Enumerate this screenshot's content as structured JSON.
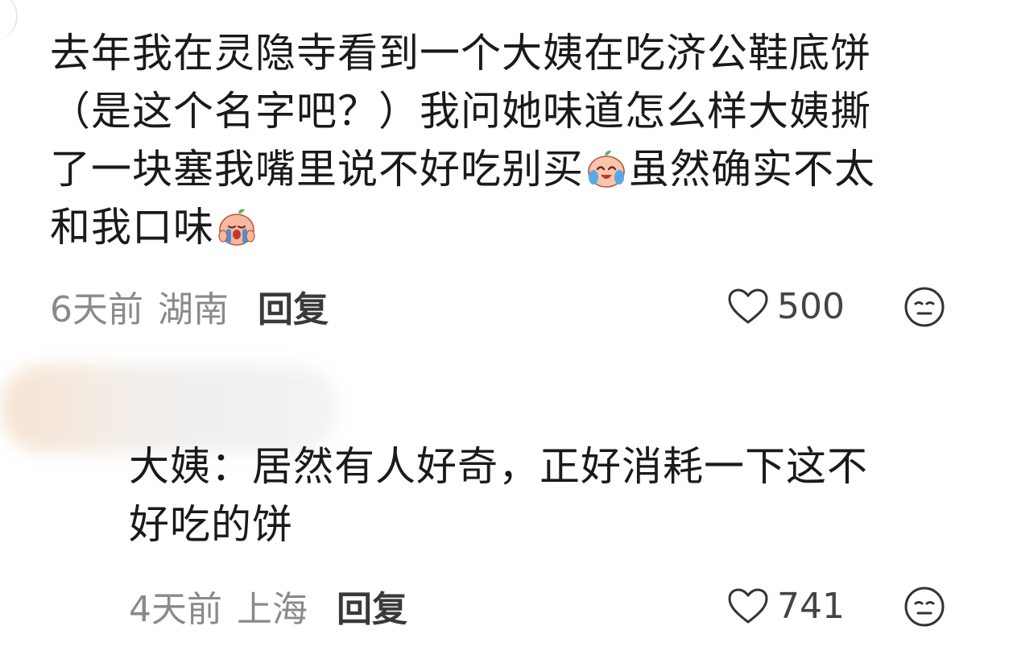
{
  "comments": [
    {
      "text_lines": [
        "去年我在灵隐寺看到一个大姨在吃济公鞋底饼",
        "（是这个名字吧？）我问她味道怎么样大姨撕",
        "了一块塞我嘴里说不好吃别买",
        "虽然确实不太",
        "和我口味"
      ],
      "emojis": [
        "laughing-crying-emoji",
        "crying-emoji"
      ],
      "time": "6天前",
      "location": "湖南",
      "reply_label": "回复",
      "likes": "500",
      "dislike_icon": "meh-face-icon",
      "like_icon": "heart-outline-icon"
    },
    {
      "text_lines": [
        "大姨：居然有人好奇，正好消耗一下这不",
        "好吃的饼"
      ],
      "time": "4天前",
      "location": "上海",
      "reply_label": "回复",
      "likes": "741",
      "dislike_icon": "meh-face-icon",
      "like_icon": "heart-outline-icon"
    }
  ],
  "colors": {
    "text": "#1a1a1a",
    "meta": "#8a8a8a",
    "reply": "#3a3a3a"
  }
}
